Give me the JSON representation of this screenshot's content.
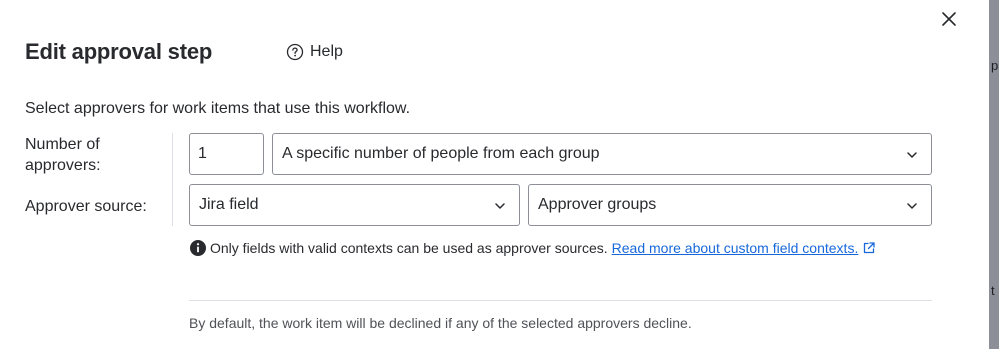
{
  "dialog": {
    "title": "Edit approval step",
    "help_label": "Help",
    "intro": "Select approvers for work items that use this workflow."
  },
  "form": {
    "number_label": "Number of approvers:",
    "number_value": "1",
    "mode_value": "A specific number of people from each group",
    "source_label": "Approver source:",
    "source_value": "Jira field",
    "groups_value": "Approver groups"
  },
  "info": {
    "text": "Only fields with valid contexts can be used as approver sources.",
    "link_text": "Read more about custom field contexts."
  },
  "footer": {
    "note": "By default, the work item will be declined if any of the selected approvers decline."
  },
  "background": {
    "peek_top": "p",
    "peek_bottom": "t"
  },
  "icons": {
    "close": "close-icon",
    "help": "question-circle-icon",
    "chevron": "chevron-down-icon",
    "info": "info-icon",
    "external": "external-link-icon"
  },
  "colors": {
    "text": "#292A2E",
    "link": "#1868DB",
    "border": "#8C8F97",
    "divider": "#DCDFE4",
    "subtle_text": "#505258",
    "backdrop": "#8C8F97"
  }
}
